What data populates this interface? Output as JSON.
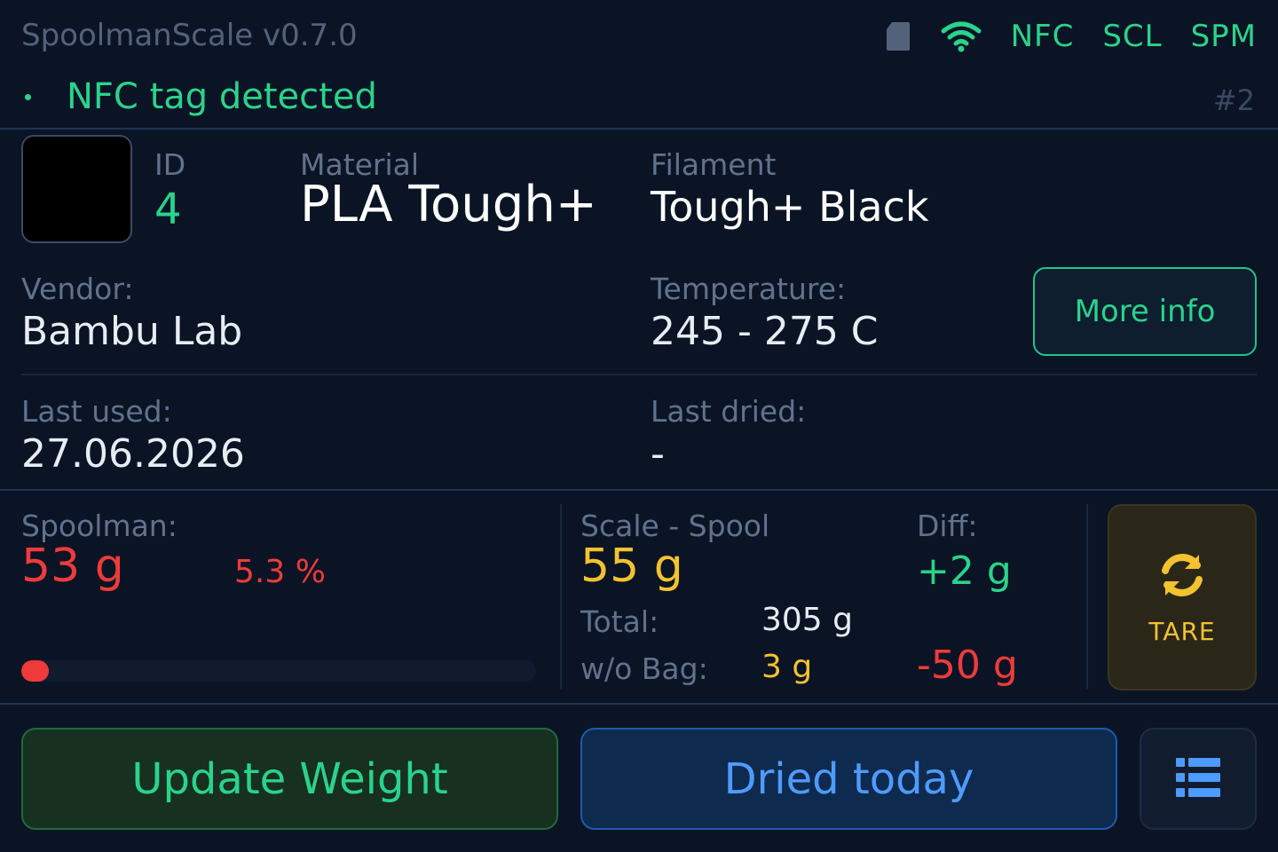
{
  "header": {
    "app_title": "SpoolmanScale v0.7.0",
    "status": {
      "nfc": "NFC",
      "scale": "SCL",
      "spoolman": "SPM"
    },
    "icons": {
      "sd": "sd-card-icon",
      "wifi": "wifi-icon"
    }
  },
  "tag": {
    "text": "NFC tag detected",
    "count": "#2"
  },
  "spool": {
    "id_label": "ID",
    "id": "4",
    "material_label": "Material",
    "material": "PLA Tough+",
    "filament_label": "Filament",
    "filament": "Tough+ Black",
    "color": "#000000",
    "vendor_label": "Vendor:",
    "vendor": "Bambu Lab",
    "temp_label": "Temperature:",
    "temperature": "245 - 275 C",
    "more_info": "More info",
    "last_used_label": "Last used:",
    "last_used": "27.06.2026",
    "last_dried_label": "Last dried:",
    "last_dried": "-"
  },
  "weights": {
    "spoolman_label": "Spoolman:",
    "spoolman": "53 g",
    "spoolman_pct": "5.3 %",
    "remaining_fraction": 0.053,
    "scale_label": "Scale - Spool",
    "scale": "55 g",
    "diff_label": "Diff:",
    "diff": "+2 g",
    "total_label": "Total:",
    "total": "305 g",
    "wobag_label": "w/o Bag:",
    "wobag": "3 g",
    "wobag_diff": "-50 g",
    "tare": "TARE"
  },
  "actions": {
    "update": "Update Weight",
    "dried": "Dried today",
    "menu_icon": "list-icon"
  },
  "colors": {
    "accent_green": "#2ad38b",
    "accent_yellow": "#f2c230",
    "accent_red": "#ef3b3b",
    "accent_blue": "#4e9bff"
  }
}
